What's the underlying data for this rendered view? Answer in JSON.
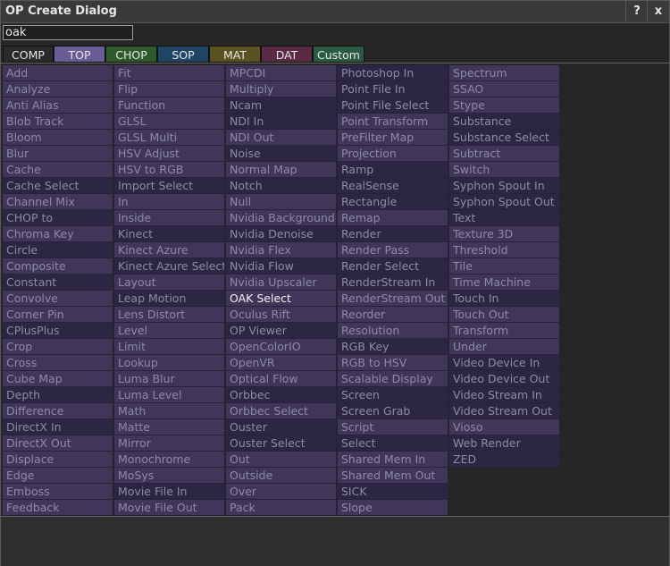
{
  "window": {
    "title": "OP Create Dialog",
    "help_label": "?",
    "close_label": "x"
  },
  "search": {
    "value": "oak"
  },
  "tabs": [
    {
      "label": "COMP",
      "bg": "#2a2a2a",
      "fg": "#e6e6e6"
    },
    {
      "label": "TOP",
      "bg": "#6a5c96",
      "fg": "#e6e6e6"
    },
    {
      "label": "CHOP",
      "bg": "#2f5a2a",
      "fg": "#e6e6e6"
    },
    {
      "label": "SOP",
      "bg": "#1f4466",
      "fg": "#e6e6e6"
    },
    {
      "label": "MAT",
      "bg": "#5a5220",
      "fg": "#e6e6e6"
    },
    {
      "label": "DAT",
      "bg": "#5a2a44",
      "fg": "#e6e6e6"
    },
    {
      "label": "Custom",
      "bg": "#2a5a44",
      "fg": "#e6e6e6"
    }
  ],
  "columns": [
    [
      {
        "l": "Add"
      },
      {
        "l": "Analyze"
      },
      {
        "l": "Anti Alias"
      },
      {
        "l": "Blob Track"
      },
      {
        "l": "Bloom"
      },
      {
        "l": "Blur"
      },
      {
        "l": "Cache"
      },
      {
        "l": "Cache Select",
        "d": 1
      },
      {
        "l": "Channel Mix"
      },
      {
        "l": "CHOP to",
        "d": 1
      },
      {
        "l": "Chroma Key"
      },
      {
        "l": "Circle",
        "d": 1
      },
      {
        "l": "Composite"
      },
      {
        "l": "Constant",
        "d": 1
      },
      {
        "l": "Convolve"
      },
      {
        "l": "Corner Pin"
      },
      {
        "l": "CPlusPlus",
        "d": 1
      },
      {
        "l": "Crop"
      },
      {
        "l": "Cross"
      },
      {
        "l": "Cube Map"
      },
      {
        "l": "Depth",
        "d": 1
      },
      {
        "l": "Difference"
      },
      {
        "l": "DirectX In",
        "d": 1
      },
      {
        "l": "DirectX Out"
      },
      {
        "l": "Displace"
      },
      {
        "l": "Edge"
      },
      {
        "l": "Emboss"
      },
      {
        "l": "Feedback"
      }
    ],
    [
      {
        "l": "Fit"
      },
      {
        "l": "Flip"
      },
      {
        "l": "Function"
      },
      {
        "l": "GLSL"
      },
      {
        "l": "GLSL Multi"
      },
      {
        "l": "HSV Adjust"
      },
      {
        "l": "HSV to RGB"
      },
      {
        "l": "Import Select",
        "d": 1
      },
      {
        "l": "In"
      },
      {
        "l": "Inside"
      },
      {
        "l": "Kinect",
        "d": 1
      },
      {
        "l": "Kinect Azure"
      },
      {
        "l": "Kinect Azure Select",
        "d": 1
      },
      {
        "l": "Layout"
      },
      {
        "l": "Leap Motion",
        "d": 1
      },
      {
        "l": "Lens Distort"
      },
      {
        "l": "Level"
      },
      {
        "l": "Limit"
      },
      {
        "l": "Lookup"
      },
      {
        "l": "Luma Blur"
      },
      {
        "l": "Luma Level"
      },
      {
        "l": "Math"
      },
      {
        "l": "Matte"
      },
      {
        "l": "Mirror"
      },
      {
        "l": "Monochrome"
      },
      {
        "l": "MoSys"
      },
      {
        "l": "Movie File In",
        "d": 1
      },
      {
        "l": "Movie File Out"
      }
    ],
    [
      {
        "l": "MPCDI"
      },
      {
        "l": "Multiply"
      },
      {
        "l": "Ncam",
        "d": 1
      },
      {
        "l": "NDI In",
        "d": 1
      },
      {
        "l": "NDI Out"
      },
      {
        "l": "Noise",
        "d": 1
      },
      {
        "l": "Normal Map"
      },
      {
        "l": "Notch",
        "d": 1
      },
      {
        "l": "Null"
      },
      {
        "l": "Nvidia Background"
      },
      {
        "l": "Nvidia Denoise",
        "d": 1
      },
      {
        "l": "Nvidia Flex"
      },
      {
        "l": "Nvidia Flow",
        "d": 1
      },
      {
        "l": "Nvidia Upscaler"
      },
      {
        "l": "OAK Select",
        "d": 1,
        "h": 1
      },
      {
        "l": "Oculus Rift"
      },
      {
        "l": "OP Viewer",
        "d": 1
      },
      {
        "l": "OpenColorIO"
      },
      {
        "l": "OpenVR"
      },
      {
        "l": "Optical Flow"
      },
      {
        "l": "Orbbec",
        "d": 1
      },
      {
        "l": "Orbbec Select"
      },
      {
        "l": "Ouster",
        "d": 1
      },
      {
        "l": "Ouster Select",
        "d": 1
      },
      {
        "l": "Out"
      },
      {
        "l": "Outside"
      },
      {
        "l": "Over"
      },
      {
        "l": "Pack"
      }
    ],
    [
      {
        "l": "Photoshop In",
        "d": 1
      },
      {
        "l": "Point File In",
        "d": 1
      },
      {
        "l": "Point File Select",
        "d": 1
      },
      {
        "l": "Point Transform"
      },
      {
        "l": "PreFilter Map"
      },
      {
        "l": "Projection"
      },
      {
        "l": "Ramp",
        "d": 1
      },
      {
        "l": "RealSense",
        "d": 1
      },
      {
        "l": "Rectangle",
        "d": 1
      },
      {
        "l": "Remap"
      },
      {
        "l": "Render",
        "d": 1
      },
      {
        "l": "Render Pass"
      },
      {
        "l": "Render Select",
        "d": 1
      },
      {
        "l": "RenderStream In",
        "d": 1
      },
      {
        "l": "RenderStream Out"
      },
      {
        "l": "Reorder"
      },
      {
        "l": "Resolution"
      },
      {
        "l": "RGB Key",
        "d": 1
      },
      {
        "l": "RGB to HSV"
      },
      {
        "l": "Scalable Display"
      },
      {
        "l": "Screen",
        "d": 1
      },
      {
        "l": "Screen Grab",
        "d": 1
      },
      {
        "l": "Script"
      },
      {
        "l": "Select",
        "d": 1
      },
      {
        "l": "Shared Mem In"
      },
      {
        "l": "Shared Mem Out"
      },
      {
        "l": "SICK",
        "d": 1
      },
      {
        "l": "Slope"
      }
    ],
    [
      {
        "l": "Spectrum"
      },
      {
        "l": "SSAO"
      },
      {
        "l": "Stype"
      },
      {
        "l": "Substance",
        "d": 1
      },
      {
        "l": "Substance Select",
        "d": 1
      },
      {
        "l": "Subtract"
      },
      {
        "l": "Switch"
      },
      {
        "l": "Syphon Spout In",
        "d": 1
      },
      {
        "l": "Syphon Spout Out",
        "d": 1
      },
      {
        "l": "Text",
        "d": 1
      },
      {
        "l": "Texture 3D"
      },
      {
        "l": "Threshold"
      },
      {
        "l": "Tile"
      },
      {
        "l": "Time Machine"
      },
      {
        "l": "Touch In",
        "d": 1
      },
      {
        "l": "Touch Out"
      },
      {
        "l": "Transform"
      },
      {
        "l": "Under"
      },
      {
        "l": "Video Device In",
        "d": 1
      },
      {
        "l": "Video Device Out",
        "d": 1
      },
      {
        "l": "Video Stream In",
        "d": 1
      },
      {
        "l": "Video Stream Out",
        "d": 1
      },
      {
        "l": "Vioso"
      },
      {
        "l": "Web Render",
        "d": 1
      },
      {
        "l": "ZED",
        "d": 1
      }
    ]
  ]
}
